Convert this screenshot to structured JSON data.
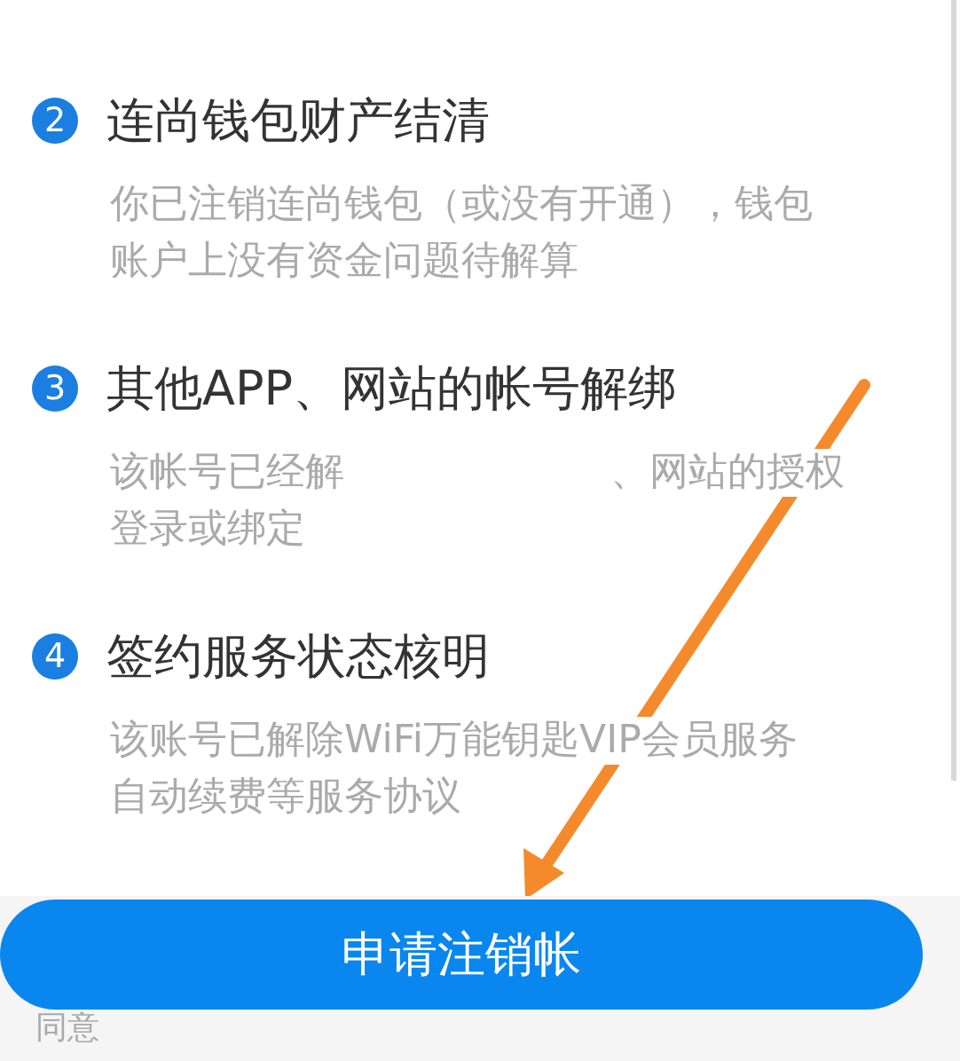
{
  "steps": [
    {
      "number": "2",
      "title": "连尚钱包财产结清",
      "lines": [
        [
          "你已注销连尚钱包（或没有开通），钱包"
        ],
        [
          "账户上没有资金问题待解算"
        ]
      ]
    },
    {
      "number": "3",
      "title": "其他APP、网站的帐号解绑",
      "lines": [
        [
          "该帐号已经解",
          "、网站的授权"
        ],
        [
          "登录或绑定"
        ]
      ]
    },
    {
      "number": "4",
      "title": "签约服务状态核明",
      "lines": [
        [
          "该账号已解除WiFi万能钥匙VIP会员服务"
        ],
        [
          "自动续费等服务协议"
        ]
      ]
    }
  ],
  "button": {
    "label": "申请注销帐"
  },
  "agree": {
    "label": "同意"
  }
}
